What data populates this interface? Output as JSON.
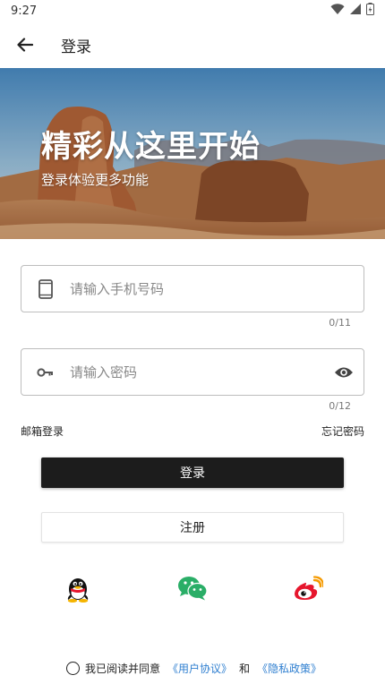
{
  "status_bar": {
    "time": "9:27"
  },
  "app_bar": {
    "title": "登录"
  },
  "hero": {
    "title": "精彩从这里开始",
    "subtitle": "登录体验更多功能"
  },
  "phone_field": {
    "placeholder": "请输入手机号码",
    "value": "",
    "counter": "0/11"
  },
  "password_field": {
    "placeholder": "请输入密码",
    "value": "",
    "counter": "0/12"
  },
  "links": {
    "email_login": "邮箱登录",
    "forgot_password": "忘记密码"
  },
  "buttons": {
    "login": "登录",
    "register": "注册"
  },
  "social": [
    "qq-icon",
    "wechat-icon",
    "weibo-icon"
  ],
  "agreement": {
    "prefix": "我已阅读并同意",
    "user_agreement": "《用户协议》",
    "and": "和",
    "privacy_policy": "《隐私政策》"
  },
  "colors": {
    "primary_button": "#1c1c1c",
    "link": "#2f7fd0",
    "wechat": "#2aae67",
    "weibo": "#e6162d"
  }
}
